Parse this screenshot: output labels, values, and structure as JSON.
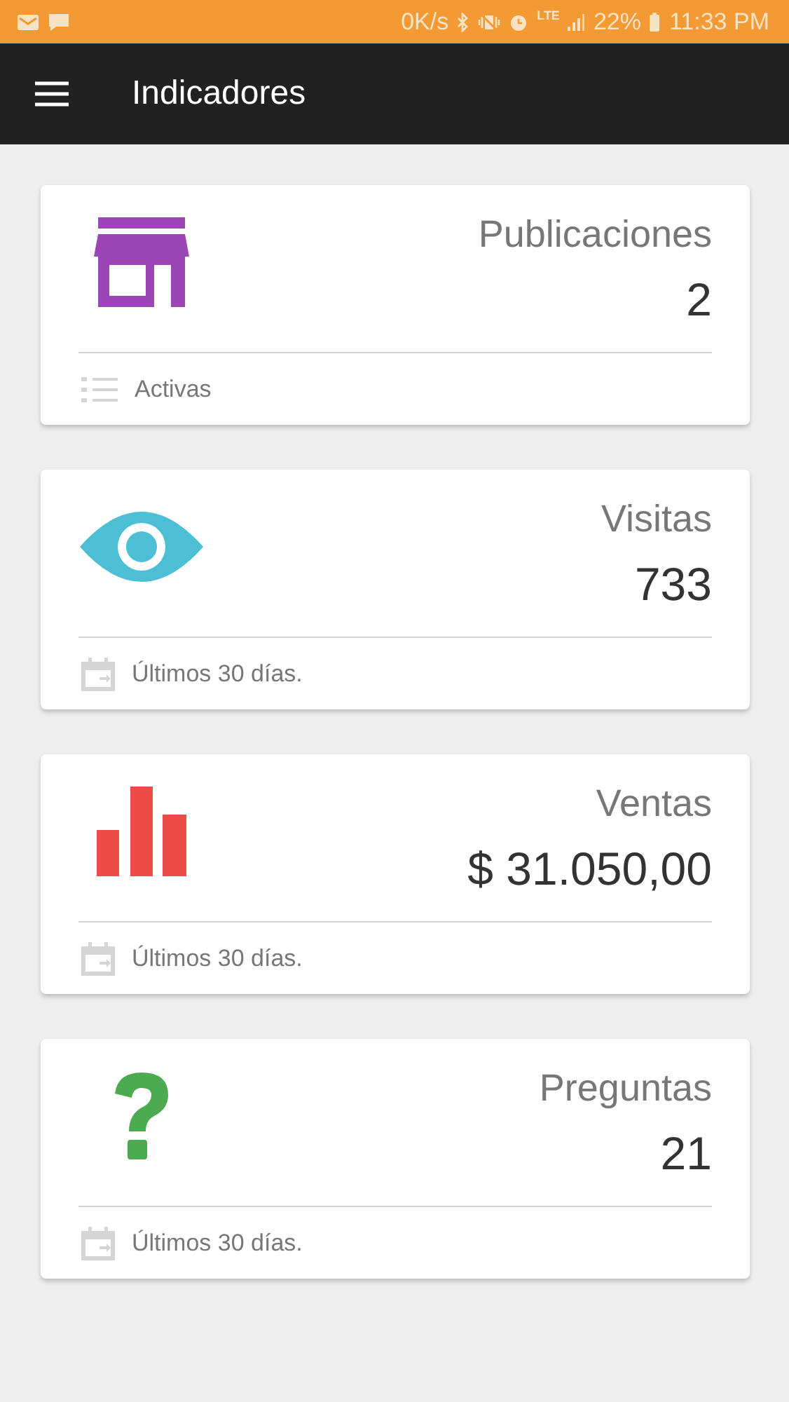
{
  "status_bar": {
    "speed": "0K/s",
    "network": "LTE",
    "battery": "22%",
    "time": "11:33 PM"
  },
  "app_bar": {
    "title": "Indicadores"
  },
  "cards": [
    {
      "kind": "store",
      "color": "#9c45b5",
      "title": "Publicaciones",
      "value": "2",
      "footer": {
        "kind": "list",
        "text": "Activas"
      }
    },
    {
      "kind": "eye",
      "color": "#4cbfd5",
      "title": "Visitas",
      "value": "733",
      "footer": {
        "kind": "calendar",
        "text": "Últimos 30 días."
      }
    },
    {
      "kind": "bars",
      "color": "#ec4b47",
      "title": "Ventas",
      "value": "$ 31.050,00",
      "footer": {
        "kind": "calendar",
        "text": "Últimos 30 días."
      }
    },
    {
      "kind": "question",
      "color": "#4caa50",
      "title": "Preguntas",
      "value": "21",
      "footer": {
        "kind": "calendar",
        "text": "Últimos 30 días."
      }
    }
  ]
}
